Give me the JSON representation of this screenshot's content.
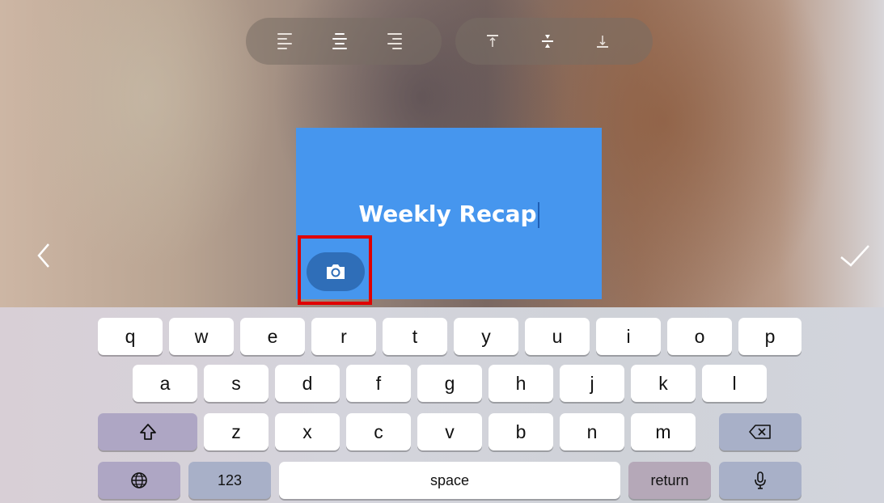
{
  "toolbar": {
    "horizontal_align": [
      {
        "icon": "align-left-icon",
        "active": false
      },
      {
        "icon": "align-center-icon",
        "active": true
      },
      {
        "icon": "align-right-icon",
        "active": false
      }
    ],
    "vertical_align": [
      {
        "icon": "align-top-icon",
        "active": false
      },
      {
        "icon": "align-middle-icon",
        "active": true
      },
      {
        "icon": "align-bottom-icon",
        "active": false
      }
    ]
  },
  "nav": {
    "back_icon": "chevron-left-icon",
    "done_icon": "checkmark-icon"
  },
  "card": {
    "title": "Weekly Recap",
    "background_color": "#4696ee",
    "camera_icon": "camera-icon"
  },
  "highlight_color": "#e00000",
  "keyboard": {
    "row1": [
      "q",
      "w",
      "e",
      "r",
      "t",
      "y",
      "u",
      "i",
      "o",
      "p"
    ],
    "row2": [
      "a",
      "s",
      "d",
      "f",
      "g",
      "h",
      "j",
      "k",
      "l"
    ],
    "row3": [
      "z",
      "x",
      "c",
      "v",
      "b",
      "n",
      "m"
    ],
    "shift_icon": "shift-icon",
    "delete_icon": "backspace-icon",
    "globe_icon": "globe-icon",
    "numbers_label": "123",
    "space_label": "space",
    "return_label": "return",
    "mic_icon": "microphone-icon"
  }
}
